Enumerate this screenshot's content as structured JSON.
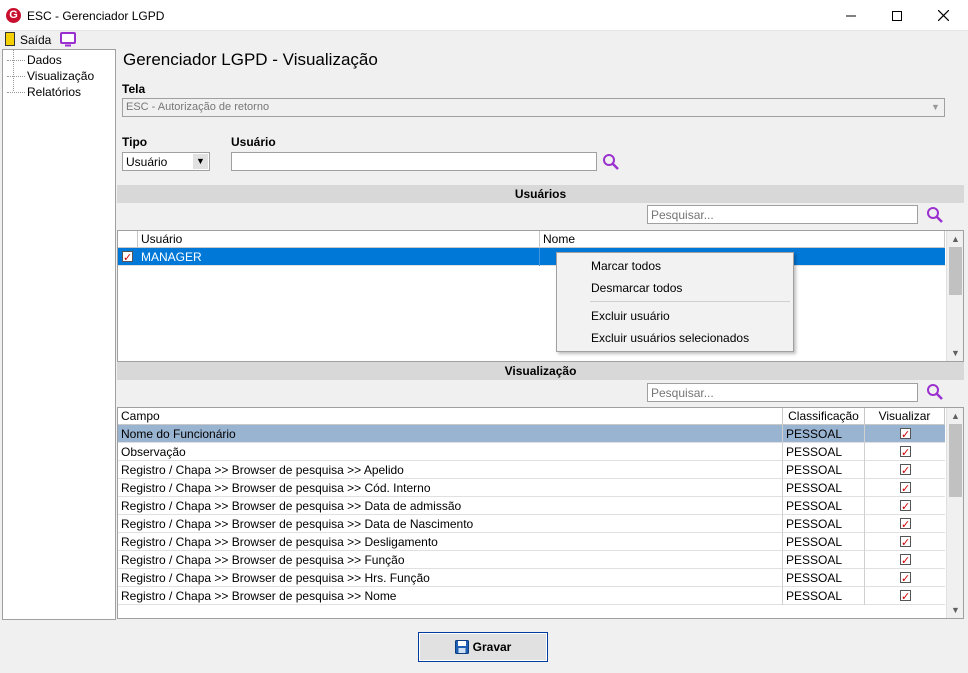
{
  "window": {
    "title": "ESC - Gerenciador LGPD",
    "logo_letter": "G"
  },
  "toolbar": {
    "exit_label": "Saída"
  },
  "sidebar": {
    "items": [
      {
        "label": "Dados"
      },
      {
        "label": "Visualização"
      },
      {
        "label": "Relatórios"
      }
    ]
  },
  "main": {
    "title": "Gerenciador LGPD - Visualização",
    "tela_label": "Tela",
    "tela_value": "ESC - Autorização de retorno",
    "tipo_label": "Tipo",
    "tipo_value": "Usuário",
    "usuario_label": "Usuário",
    "usuario_value": ""
  },
  "users_section": {
    "title": "Usuários",
    "search_placeholder": "Pesquisar...",
    "columns": [
      "Usuário",
      "Nome"
    ],
    "rows": [
      {
        "checked": true,
        "usuario": "MANAGER",
        "nome": ""
      }
    ]
  },
  "context_menu": {
    "items": [
      {
        "label": "Marcar todos"
      },
      {
        "label": "Desmarcar todos"
      },
      {
        "label": "Excluir usuário"
      },
      {
        "label": "Excluir usuários selecionados"
      }
    ]
  },
  "view_section": {
    "title": "Visualização",
    "search_placeholder": "Pesquisar...",
    "columns": [
      "Campo",
      "Classificação",
      "Visualizar"
    ],
    "rows": [
      {
        "campo": "Nome do Funcionário",
        "classificacao": "PESSOAL",
        "visualizar": true
      },
      {
        "campo": "Observação",
        "classificacao": "PESSOAL",
        "visualizar": true
      },
      {
        "campo": "Registro / Chapa >> Browser de pesquisa >> Apelido",
        "classificacao": "PESSOAL",
        "visualizar": true
      },
      {
        "campo": "Registro / Chapa >> Browser de pesquisa >> Cód. Interno",
        "classificacao": "PESSOAL",
        "visualizar": true
      },
      {
        "campo": "Registro / Chapa >> Browser de pesquisa >> Data de admissão",
        "classificacao": "PESSOAL",
        "visualizar": true
      },
      {
        "campo": "Registro / Chapa >> Browser de pesquisa >> Data de Nascimento",
        "classificacao": "PESSOAL",
        "visualizar": true
      },
      {
        "campo": "Registro / Chapa >> Browser de pesquisa >> Desligamento",
        "classificacao": "PESSOAL",
        "visualizar": true
      },
      {
        "campo": "Registro / Chapa >> Browser de pesquisa >> Função",
        "classificacao": "PESSOAL",
        "visualizar": true
      },
      {
        "campo": "Registro / Chapa >> Browser de pesquisa >> Hrs. Função",
        "classificacao": "PESSOAL",
        "visualizar": true
      },
      {
        "campo": "Registro / Chapa >> Browser de pesquisa >> Nome",
        "classificacao": "PESSOAL",
        "visualizar": true
      }
    ]
  },
  "footer": {
    "save_label": "Gravar"
  },
  "colors": {
    "selection": "#0078d7",
    "row_highlight": "#99b4d1",
    "accent_icon": "#9b30d0",
    "logo": "#c8102e"
  }
}
